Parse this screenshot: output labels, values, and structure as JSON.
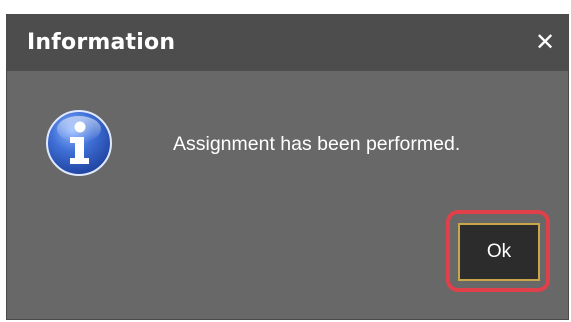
{
  "dialog": {
    "title": "Information",
    "close_glyph": "✕",
    "icon": "information-icon",
    "message": "Assignment has been performed.",
    "ok_label": "Ok"
  },
  "colors": {
    "dialog_background": "#686868",
    "titlebar_background": "#4d4d4d",
    "ok_button_border": "#c9a64a",
    "highlight_outline": "#e0404a",
    "icon_blue": "#2f5fc0"
  }
}
